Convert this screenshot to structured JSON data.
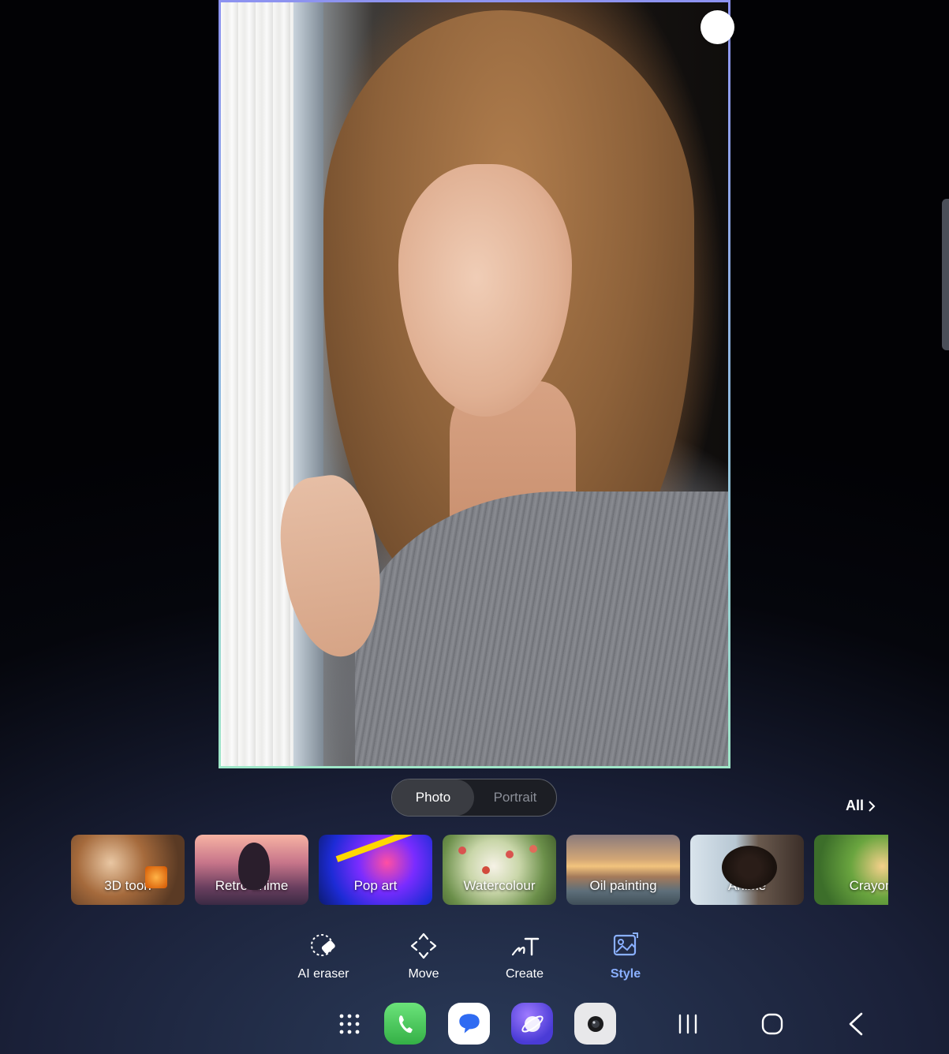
{
  "editor": {
    "mode_tabs": [
      {
        "label": "Photo",
        "active": true
      },
      {
        "label": "Portrait",
        "active": false
      }
    ],
    "all_label": "All"
  },
  "styles": [
    {
      "label": "3D toon"
    },
    {
      "label": "Retro anime"
    },
    {
      "label": "Pop art"
    },
    {
      "label": "Watercolour"
    },
    {
      "label": "Oil painting"
    },
    {
      "label": "Anime"
    },
    {
      "label": "Crayon"
    }
  ],
  "tools": [
    {
      "label": "AI eraser",
      "icon": "ai-eraser-icon"
    },
    {
      "label": "Move",
      "icon": "move-icon"
    },
    {
      "label": "Create",
      "icon": "create-icon"
    },
    {
      "label": "Style",
      "icon": "style-icon",
      "active": true
    }
  ],
  "dock": {
    "apps": [
      "apps-grid-icon",
      "phone-icon",
      "messages-icon",
      "internet-icon",
      "camera-icon"
    ],
    "nav": [
      "recents-icon",
      "home-icon",
      "back-icon"
    ]
  },
  "colors": {
    "accent": "#8ab0ff",
    "frame_gradient_top": "#8d93f0",
    "frame_gradient_bottom": "#9fe6c8"
  }
}
